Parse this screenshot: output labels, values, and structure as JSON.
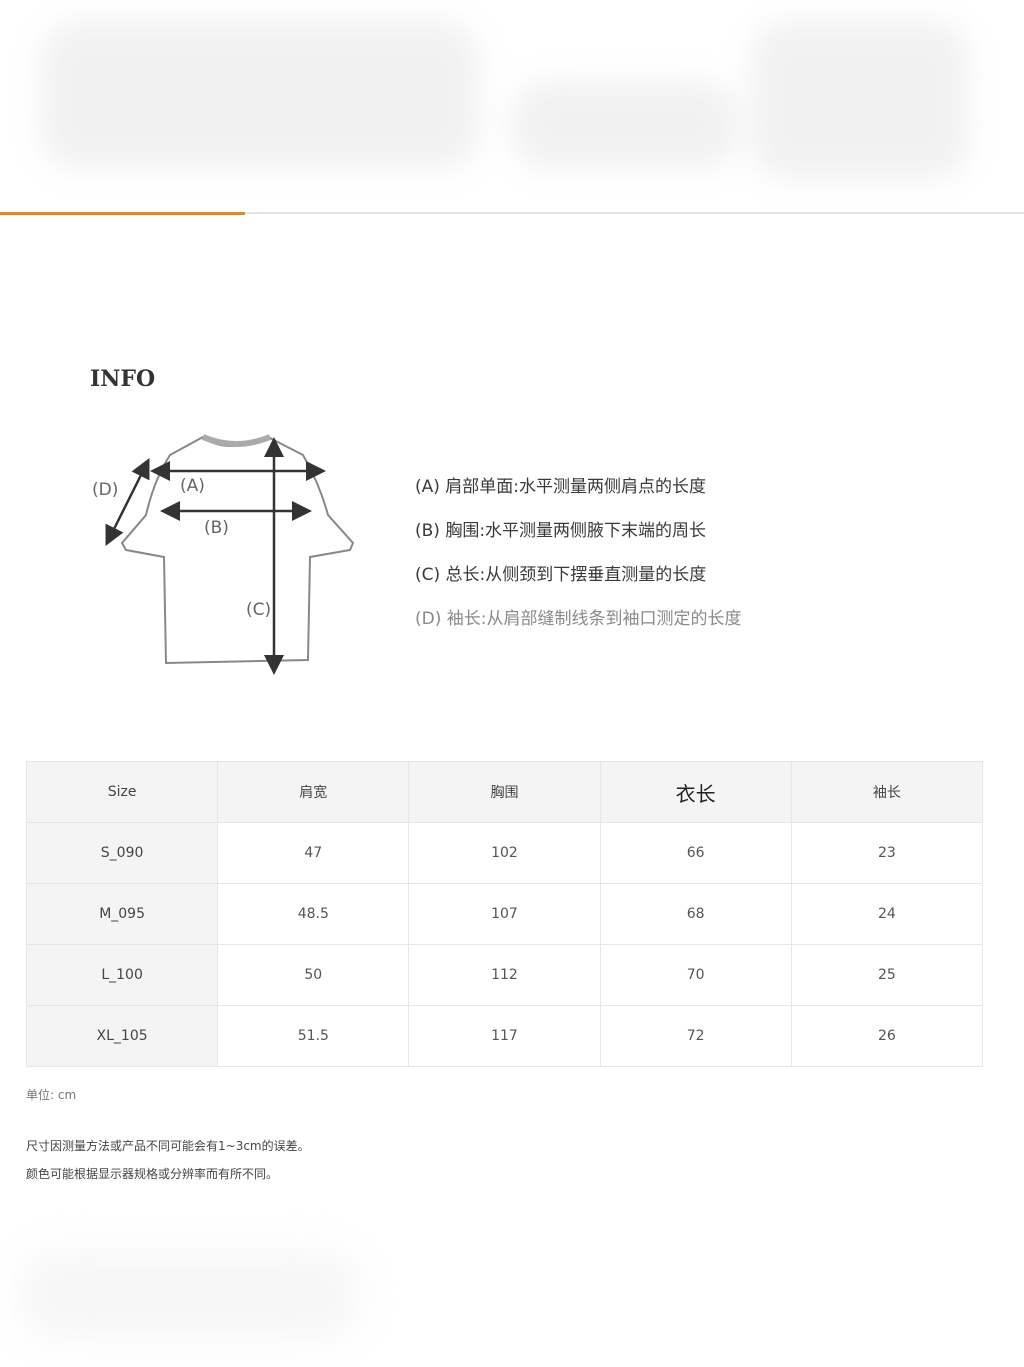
{
  "info_title": "INFO",
  "diagram_labels": {
    "a": "(A)",
    "b": "(B)",
    "c": "(C)",
    "d": "(D)"
  },
  "legend": [
    "(A) 肩部单面:水平测量两侧肩点的长度",
    "(B) 胸围:水平测量两侧腋下末端的周长",
    "(C) 总长:从侧颈到下摆垂直测量的长度",
    "(D) 袖长:从肩部缝制线条到袖口测定的长度"
  ],
  "table": {
    "headers": [
      "Size",
      "肩宽",
      "胸围",
      "衣长",
      "袖长"
    ],
    "rows": [
      [
        "S_090",
        "47",
        "102",
        "66",
        "23"
      ],
      [
        "M_095",
        "48.5",
        "107",
        "68",
        "24"
      ],
      [
        "L_100",
        "50",
        "112",
        "70",
        "25"
      ],
      [
        "XL_105",
        "51.5",
        "117",
        "72",
        "26"
      ]
    ]
  },
  "unit": "单位: cm",
  "notes": [
    "尺寸因测量方法或产品不同可能会有1~3cm的误差。",
    "颜色可能根据显示器规格或分辨率而有所不同。"
  ],
  "colors": {
    "accent": "#e08a1e",
    "header_bg": "#f4f4f4",
    "border": "#e6e6e6"
  }
}
